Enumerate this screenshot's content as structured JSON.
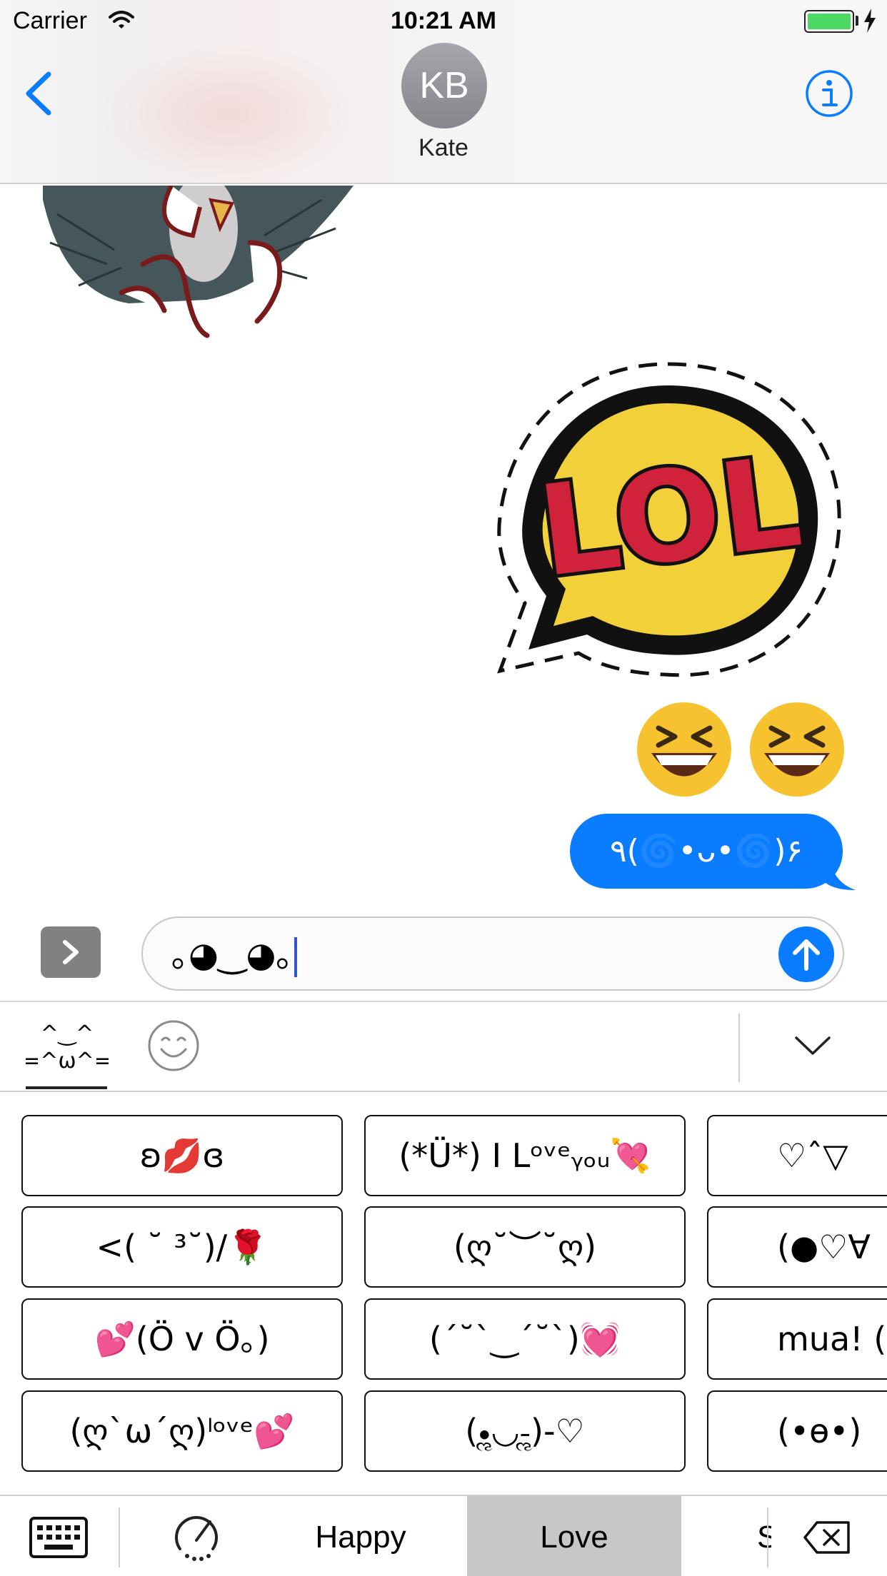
{
  "status_bar": {
    "carrier": "Carrier",
    "time": "10:21 AM",
    "battery_level": 1.0,
    "charging": true
  },
  "header": {
    "avatar_initials": "KB",
    "contact_name": "Kate",
    "back_icon": "chevron-left-icon",
    "info_icon": "info-icon"
  },
  "conversation": {
    "lol_sticker_text": "LOL",
    "emoji_message": "😆😆",
    "outgoing_message": "٩(🌀•ᴗ•🌀)۶"
  },
  "compose": {
    "input_value": "｡◕‿◕｡",
    "send_icon": "arrow-up-icon"
  },
  "keyboard": {
    "tabs": [
      {
        "label": "^‿^\n(=^ω^=)",
        "icon": "cat-kaomoji-icon",
        "active": true
      },
      {
        "icon": "smiley-icon",
        "active": false
      }
    ],
    "grid": [
      [
        "ʚ💋ɞ",
        "(*Ü*) I Lᵒᵛᵉᵧₒᵤ💘",
        "♡ˆ▽"
      ],
      [
        "<( ˘ ³˘)/🌹",
        "(ღ˘︶˘ღ)",
        "(●♡∀"
      ],
      [
        "💕(Ö v Ö｡)",
        "(´˘`‿´˘`)💓",
        "mua! (*-"
      ],
      [
        "(ღ`ω´ღ)ˡᵒᵛᵉ💕",
        "(•ૢ◡-ૢ)-♡",
        "(•ɵ•)"
      ]
    ],
    "categories": {
      "happy": "Happy",
      "love": "Love",
      "partial": "S"
    },
    "selected_category": "Love"
  },
  "colors": {
    "accent": "#0a7cff",
    "selected_category_bg": "#c7c7c7",
    "avatar_bg": "#8e8e93",
    "apps_button_bg": "#818181"
  }
}
